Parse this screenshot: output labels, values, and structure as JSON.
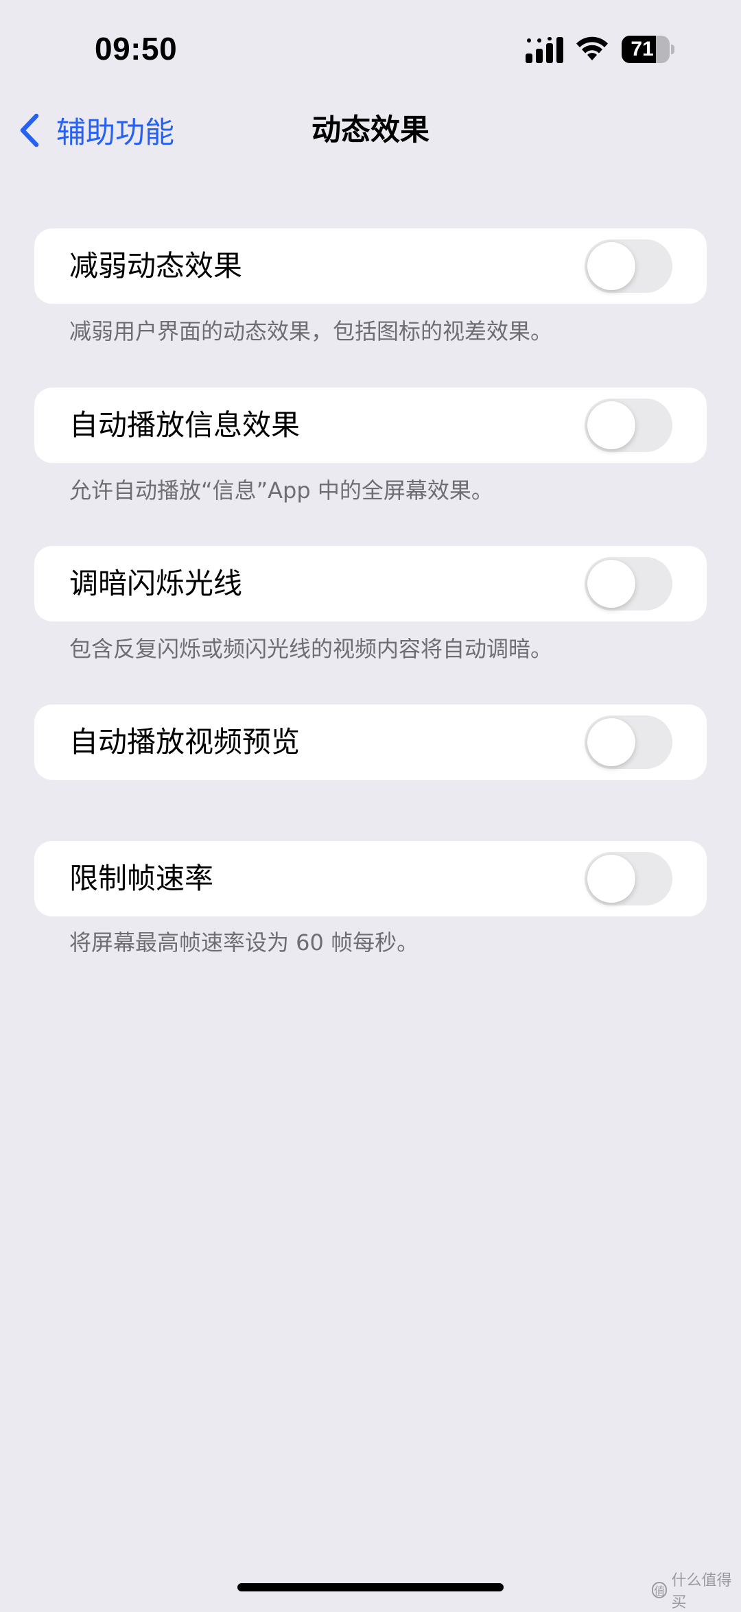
{
  "status_bar": {
    "time": "09:50",
    "battery_percent": "71",
    "battery_level": 0.71,
    "icons": [
      "cellular-signal-icon",
      "wifi-icon",
      "battery-icon"
    ]
  },
  "nav": {
    "back_label": "辅助功能",
    "title": "动态效果",
    "accent_color": "#2660F5"
  },
  "settings": [
    {
      "label": "减弱动态效果",
      "enabled": false,
      "footnote": "减弱用户界面的动态效果，包括图标的视差效果。"
    },
    {
      "label": "自动播放信息效果",
      "enabled": false,
      "footnote": "允许自动播放“信息”App 中的全屏幕效果。"
    },
    {
      "label": "调暗闪烁光线",
      "enabled": false,
      "footnote": "包含反复闪烁或频闪光线的视频内容将自动调暗。"
    },
    {
      "label": "自动播放视频预览",
      "enabled": false
    },
    {
      "label": "限制帧速率",
      "enabled": false,
      "footnote": "将屏幕最高帧速率设为 60 帧每秒。"
    }
  ],
  "watermark": {
    "logo": "值",
    "text": "什么值得买"
  }
}
